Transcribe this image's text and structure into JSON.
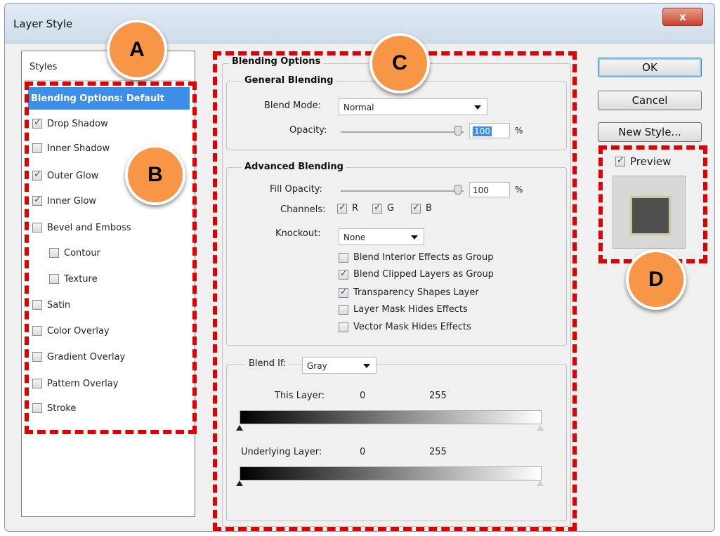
{
  "window": {
    "title": "Layer Style",
    "close_label": "x"
  },
  "styles": {
    "header": "Styles",
    "items": [
      {
        "label": "Blending Options: Default",
        "active": true,
        "checkbox": false,
        "checked": false,
        "indent": false
      },
      {
        "label": "Drop Shadow",
        "checkbox": true,
        "checked": true,
        "indent": false
      },
      {
        "label": "Inner Shadow",
        "checkbox": true,
        "checked": false,
        "indent": false
      },
      {
        "label": "Outer Glow",
        "checkbox": true,
        "checked": true,
        "indent": false
      },
      {
        "label": "Inner Glow",
        "checkbox": true,
        "checked": true,
        "indent": false
      },
      {
        "label": "Bevel and Emboss",
        "checkbox": true,
        "checked": false,
        "indent": false
      },
      {
        "label": "Contour",
        "checkbox": true,
        "checked": false,
        "indent": true
      },
      {
        "label": "Texture",
        "checkbox": true,
        "checked": false,
        "indent": true
      },
      {
        "label": "Satin",
        "checkbox": true,
        "checked": false,
        "indent": false
      },
      {
        "label": "Color Overlay",
        "checkbox": true,
        "checked": false,
        "indent": false
      },
      {
        "label": "Gradient Overlay",
        "checkbox": true,
        "checked": false,
        "indent": false
      },
      {
        "label": "Pattern Overlay",
        "checkbox": true,
        "checked": false,
        "indent": false
      },
      {
        "label": "Stroke",
        "checkbox": true,
        "checked": false,
        "indent": false
      }
    ]
  },
  "blending": {
    "section_title": "Blending Options",
    "general": {
      "title": "General Blending",
      "blend_mode_label": "Blend Mode:",
      "blend_mode_value": "Normal",
      "opacity_label": "Opacity:",
      "opacity_value": "100",
      "opacity_unit": "%"
    },
    "advanced": {
      "title": "Advanced Blending",
      "fill_opacity_label": "Fill Opacity:",
      "fill_opacity_value": "100",
      "fill_opacity_unit": "%",
      "channels_label": "Channels:",
      "channel_r": "R",
      "channel_g": "G",
      "channel_b": "B",
      "knockout_label": "Knockout:",
      "knockout_value": "None",
      "options": [
        {
          "label": "Blend Interior Effects as Group",
          "checked": false
        },
        {
          "label": "Blend Clipped Layers as Group",
          "checked": true
        },
        {
          "label": "Transparency Shapes Layer",
          "checked": true
        },
        {
          "label": "Layer Mask Hides Effects",
          "checked": false
        },
        {
          "label": "Vector Mask Hides Effects",
          "checked": false
        }
      ]
    },
    "blend_if": {
      "label": "Blend If:",
      "value": "Gray",
      "this_layer_label": "This Layer:",
      "this_layer_min": "0",
      "this_layer_max": "255",
      "underlying_label": "Underlying Layer:",
      "underlying_min": "0",
      "underlying_max": "255"
    }
  },
  "buttons": {
    "ok": "OK",
    "cancel": "Cancel",
    "new_style": "New Style..."
  },
  "preview": {
    "label": "Preview",
    "checked": true
  },
  "annotations": {
    "markers": [
      "A",
      "B",
      "C",
      "D"
    ],
    "marker_color": "#f79646",
    "outline_color": "#e00000"
  }
}
